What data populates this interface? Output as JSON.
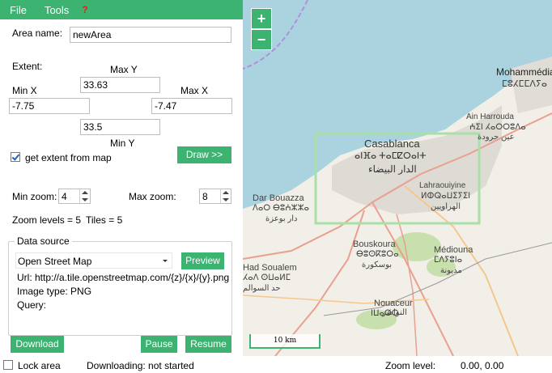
{
  "menu": {
    "file": "File",
    "tools": "Tools",
    "help": "?"
  },
  "area": {
    "label": "Area name:",
    "value": "newArea"
  },
  "extent": {
    "label": "Extent:",
    "max_y_label": "Max Y",
    "max_y": "33.63",
    "min_x_label": "Min X",
    "min_x": "-7.75",
    "max_x_label": "Max X",
    "max_x": "-7.47",
    "min_y_label": "Min Y",
    "min_y": "33.5",
    "get_from_map_label": "get extent from map",
    "get_from_map_checked": true,
    "draw_button": "Draw >>"
  },
  "zoom": {
    "min_label": "Min zoom:",
    "min_value": "4",
    "max_label": "Max zoom:",
    "max_value": "8",
    "levels_text": "Zoom levels = 5",
    "tiles_text": "Tiles = 5"
  },
  "source": {
    "legend": "Data source",
    "selected": "Open Street Map",
    "preview_button": "Preview",
    "url_text": "Url: http://a.tile.openstreetmap.com/{z}/{x}/{y}.png",
    "image_type_text": "Image type: PNG",
    "query_text": "Query:"
  },
  "actions": {
    "download": "Download",
    "pause": "Pause",
    "resume": "Resume"
  },
  "status": {
    "lock_label": "Lock area",
    "lock_checked": false,
    "downloading_text": "Downloading: not started",
    "zoom_level_label": "Zoom level:",
    "coords_text": "0.00, 0.00"
  },
  "map": {
    "zoom_in": "+",
    "zoom_out": "−",
    "scale_text": "10 km",
    "labels": {
      "mohammedia": "Mohammédia",
      "mohammedia_tif": "ⵎⵓⵃⵎⵎⴷⵢⴰ",
      "ain_harrouda": "Ain Harrouda",
      "ain_harrouda_tif": "ⵄⵉⵏ ⵃⴰⵔⵔⵓⴷⴰ",
      "ain_harrouda_ar": "عين حرودة",
      "casablanca": "Casablanca",
      "casablanca_tif": "ⴰⵏⴼⴰ ⵜⴰⵎⵇⵔⴰⵏⵜ",
      "casablanca_ar": "الدار البيضاء",
      "lahraouiyine": "Lahraouiyine",
      "lahraouiyine_tif": "ⵍⵀⵕⴰⵡⵉⵢⵉⵏ",
      "lahraouiyine_ar": "الهراويين",
      "dar_bouazza": "Dar Bouazza",
      "dar_bouazza_tif": "ⴷⴰⵔ ⴱⵓⵄⵣⵣⴰ",
      "dar_bouazza_ar": "دار بوعزة",
      "bouskoura": "Bouskoura",
      "bouskoura_tif": "ⴱⵓⵙⴽⵓⵔⴰ",
      "bouskoura_ar": "بوسكورة",
      "mediouna": "Médiouna",
      "mediouna_tif": "ⵎⴷⵢⵓⵏⴰ",
      "mediouna_ar": "مديونة",
      "had_soualem": "Had Soualem",
      "had_soualem_tif": "ⵃⴰⴷ ⵙⵡⴰⵍⵎ",
      "had_soualem_ar": "حد السوالم",
      "nouaceur": "Nouaceur",
      "nouaceur_tif": "ⵏⵡⴰⵚⵔ",
      "nouaceur_ar": "النواصر"
    }
  },
  "colors": {
    "accent": "#3cb371",
    "sea": "#aad3df",
    "land": "#f2efe9",
    "selection": "#a8e0a8"
  }
}
